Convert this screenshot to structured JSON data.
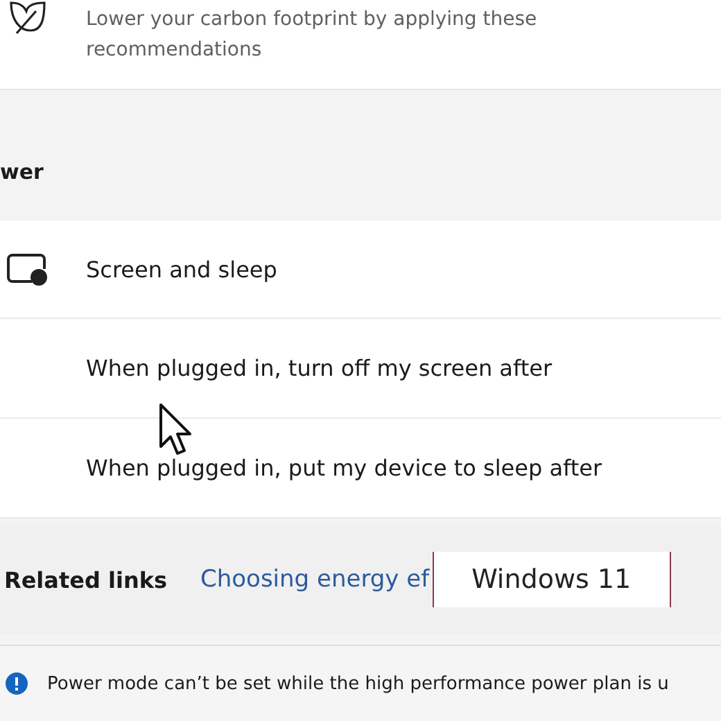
{
  "recommendation": {
    "description": "Lower your carbon footprint by applying these recommendations"
  },
  "section_heading": "wer",
  "screen_and_sleep": {
    "title": "Screen and sleep",
    "expanded": true,
    "rows": [
      {
        "label": "When plugged in, turn off my screen after"
      },
      {
        "label": "When plugged in, put my device to sleep after"
      }
    ]
  },
  "related_links": {
    "label": "Related links",
    "links": [
      "Choosing energy ef"
    ]
  },
  "video_caption": "Windows 11",
  "info_bar": {
    "message": "Power mode can’t be set while the high performance power plan is u"
  }
}
